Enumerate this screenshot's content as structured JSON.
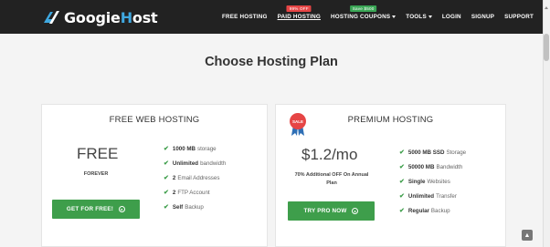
{
  "header": {
    "logo_text_pre": "Googie",
    "logo_text_accent": "H",
    "logo_text_post": "ost",
    "nav": [
      {
        "label": "FREE HOSTING",
        "caret": false
      },
      {
        "label": "PAID HOSTING",
        "caret": false,
        "badge": "99% OFF",
        "badge_color": "#e64545",
        "active": true
      },
      {
        "label": "HOSTING COUPONS",
        "caret": true,
        "badge": "Save $500",
        "badge_color": "#3aa655"
      },
      {
        "label": "TOOLS",
        "caret": true
      },
      {
        "label": "LOGIN",
        "caret": false
      },
      {
        "label": "SIGNUP",
        "caret": false
      },
      {
        "label": "SUPPORT",
        "caret": false
      }
    ]
  },
  "main": {
    "title": "Choose Hosting Plan"
  },
  "free_plan": {
    "title": "FREE WEB HOSTING",
    "price": "FREE",
    "price_sub": "FOREVER",
    "cta": "GET FOR FREE!",
    "features": [
      {
        "bold": "1000 MB",
        "text": "storage"
      },
      {
        "bold": "Unlimited",
        "text": "bandwidth"
      },
      {
        "bold": "2",
        "text": "Email Addresses"
      },
      {
        "bold": "2",
        "text": "FTP Account"
      },
      {
        "bold": "Self",
        "text": "Backup"
      }
    ]
  },
  "premium_plan": {
    "title": "PREMIUM HOSTING",
    "badge": "SALE",
    "price": "$1.2/mo",
    "price_sub_line1": "70% Additional OFF On Annual",
    "price_sub_line2": "Plan",
    "cta": "TRY PRO NOW",
    "features": [
      {
        "bold": "5000 MB SSD",
        "text": "Storage"
      },
      {
        "bold": "50000 MB",
        "text": "Bandwidth"
      },
      {
        "bold": "Single",
        "text": "Websites"
      },
      {
        "bold": "Unlimited",
        "text": "Transfer"
      },
      {
        "bold": "Regular",
        "text": "Backup"
      }
    ]
  },
  "colors": {
    "header_bg": "#222222",
    "accent_green": "#3e9e4b",
    "logo_accent": "#3fa8e0",
    "sale_red": "#e64545"
  }
}
